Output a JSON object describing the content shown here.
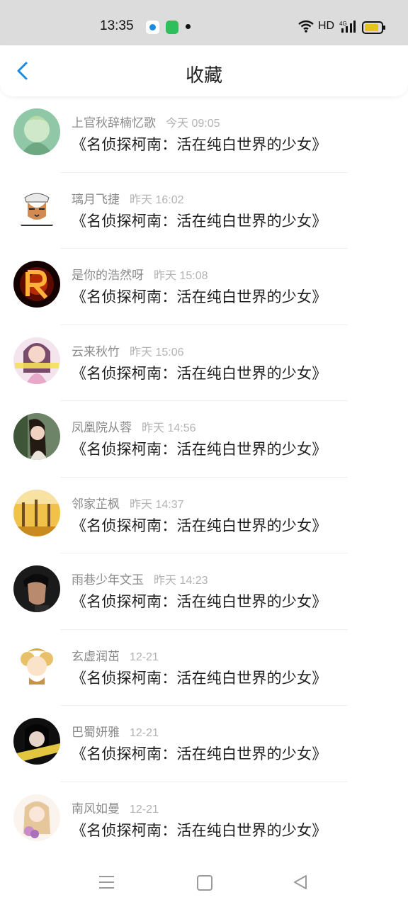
{
  "status_bar": {
    "time": "13:35",
    "network_label": "HD",
    "signal_label": "4G",
    "icons": [
      "app-notification-icon",
      "app-notification-icon",
      "wifi-icon",
      "signal-icon",
      "battery-icon"
    ],
    "battery_color": "#e6c21c"
  },
  "header": {
    "title": "收藏",
    "back_icon": "chevron-left-icon",
    "accent_color": "#1b8be0"
  },
  "items": [
    {
      "name": "上官秋辞楠忆歌",
      "time": "今天 09:05",
      "title": "《名侦探柯南：活在纯白世界的少女》"
    },
    {
      "name": "璃月飞捷",
      "time": "昨天 16:02",
      "title": "《名侦探柯南：活在纯白世界的少女》"
    },
    {
      "name": "是你的浩然呀",
      "time": "昨天 15:08",
      "title": "《名侦探柯南：活在纯白世界的少女》"
    },
    {
      "name": "云来秋竹",
      "time": "昨天 15:06",
      "title": "《名侦探柯南：活在纯白世界的少女》"
    },
    {
      "name": "凤凰院从蓉",
      "time": "昨天 14:56",
      "title": "《名侦探柯南：活在纯白世界的少女》"
    },
    {
      "name": "邻家芷枫",
      "time": "昨天 14:37",
      "title": "《名侦探柯南：活在纯白世界的少女》"
    },
    {
      "name": "雨巷少年文玉",
      "time": "昨天 14:23",
      "title": "《名侦探柯南：活在纯白世界的少女》"
    },
    {
      "name": "玄虚润茁",
      "time": "12-21",
      "title": "《名侦探柯南：活在纯白世界的少女》"
    },
    {
      "name": "巴蜀妍雅",
      "time": "12-21",
      "title": "《名侦探柯南：活在纯白世界的少女》"
    },
    {
      "name": "南风如曼",
      "time": "12-21",
      "title": "《名侦探柯南：活在纯白世界的少女》"
    }
  ],
  "nav_bar": {
    "icons": [
      "menu-icon",
      "home-icon",
      "back-triangle-icon"
    ]
  }
}
